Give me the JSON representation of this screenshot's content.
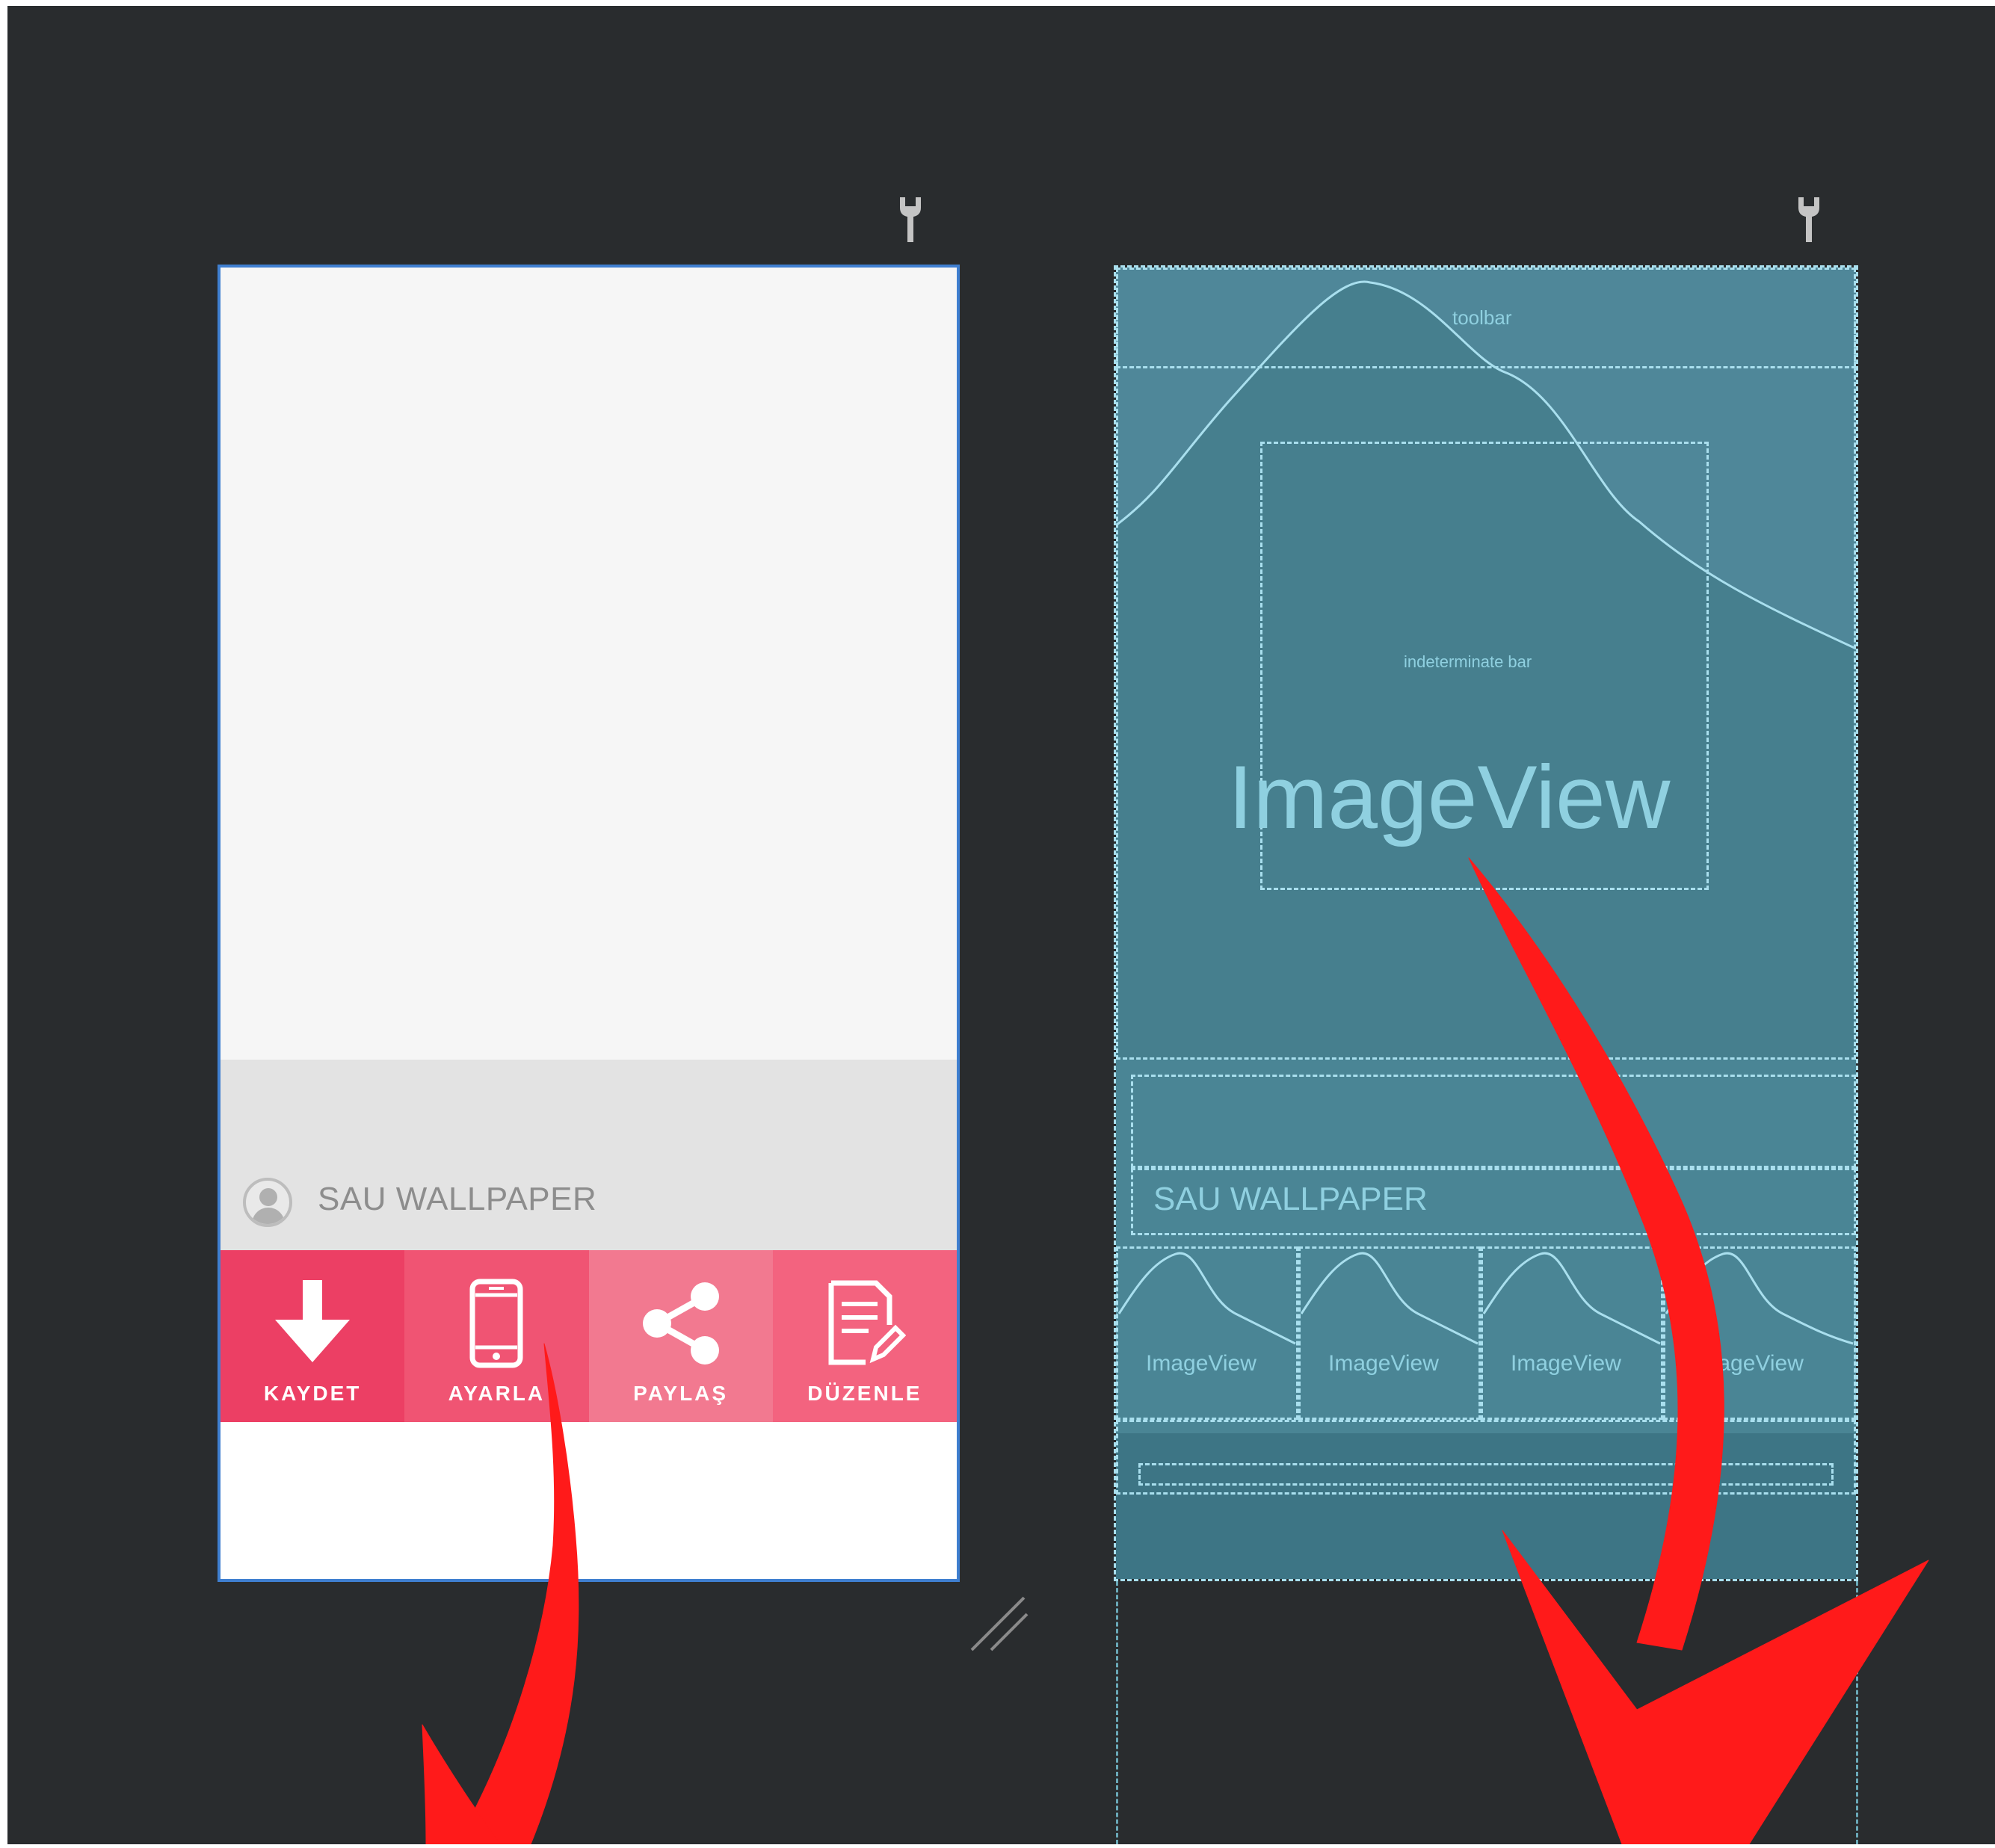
{
  "design_preview": {
    "app_title": "SAU WALLPAPER",
    "actions": [
      {
        "label": "KAYDET",
        "icon": "download-arrow-icon",
        "color": "#ec3f64"
      },
      {
        "label": "AYARLA",
        "icon": "smartphone-icon",
        "color": "#f05473"
      },
      {
        "label": "PAYLAŞ",
        "icon": "share-icon",
        "color": "#f27990"
      },
      {
        "label": "DÜZENLE",
        "icon": "edit-document-icon",
        "color": "#f3637f"
      }
    ]
  },
  "blueprint": {
    "toolbar_label": "toolbar",
    "progress_label": "indeterminate bar",
    "imageview_label": "ImageView",
    "title_text": "SAU WALLPAPER",
    "thumbnails": [
      {
        "label": "ImageView"
      },
      {
        "label": "ImageView"
      },
      {
        "label": "ImageView"
      },
      {
        "label": "ImageView"
      }
    ]
  },
  "colors": {
    "canvas_bg": "#292c2e",
    "blueprint_bg": "#467d8d",
    "blueprint_line": "#a9dfee",
    "selection_outline": "#3f7fd0",
    "annotation_arrow": "#ff1a1a"
  }
}
